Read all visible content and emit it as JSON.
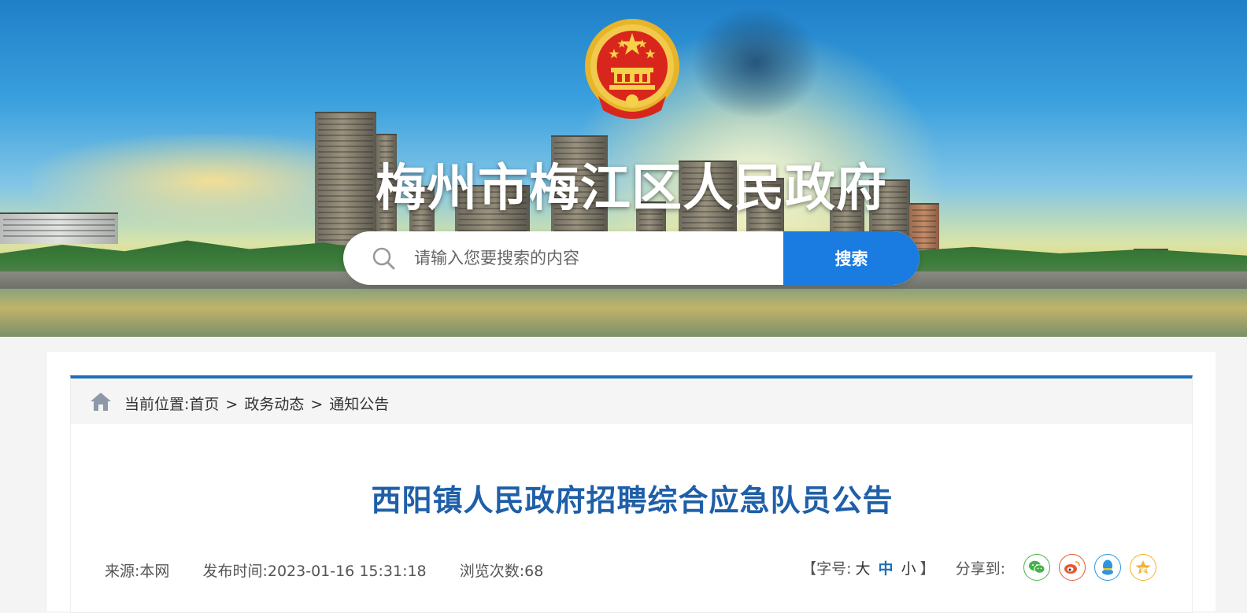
{
  "header": {
    "site_title": "梅州市梅江区人民政府",
    "emblem_icon": "national-emblem-icon"
  },
  "search": {
    "placeholder": "请输入您要搜索的内容",
    "button_label": "搜索",
    "accent_color": "#1a7be0"
  },
  "breadcrumb": {
    "prefix": "当前位置:",
    "items": [
      "首页",
      "政务动态",
      "通知公告"
    ],
    "separator": ">"
  },
  "article": {
    "title": "西阳镇人民政府招聘综合应急队员公告",
    "source": "来源:本网",
    "publish_time": "发布时间:2023-01-16 15:31:18",
    "views": "浏览次数:68",
    "font_size": {
      "open": "【字号:",
      "large": "大",
      "medium": "中",
      "small": "小",
      "close": "】"
    },
    "share_label": "分享到:",
    "share_icons": [
      "wechat-icon",
      "weibo-icon",
      "qq-icon",
      "qzone-icon"
    ]
  },
  "colors": {
    "title_blue": "#1f5fa8",
    "breadcrumb_border": "#1f6fb8"
  }
}
